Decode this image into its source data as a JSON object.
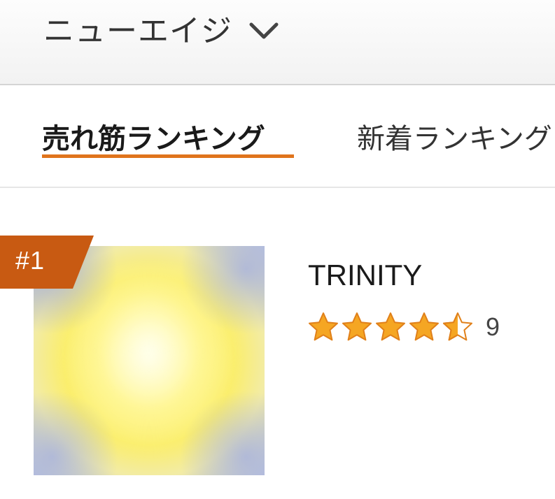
{
  "header": {
    "category_label": "ニューエイジ",
    "category_icon": "chevron-down-icon"
  },
  "tabs": [
    {
      "label": "売れ筋ランキング",
      "active": true
    },
    {
      "label": "新着ランキング",
      "active": false
    }
  ],
  "colors": {
    "accent": "#e0741c",
    "badge": "#c85a12",
    "star": "#f5a623",
    "star_outline": "#e0801a"
  },
  "items": [
    {
      "rank": "#1",
      "title": "TRINITY",
      "rating": 4.5,
      "review_count": "9"
    }
  ]
}
